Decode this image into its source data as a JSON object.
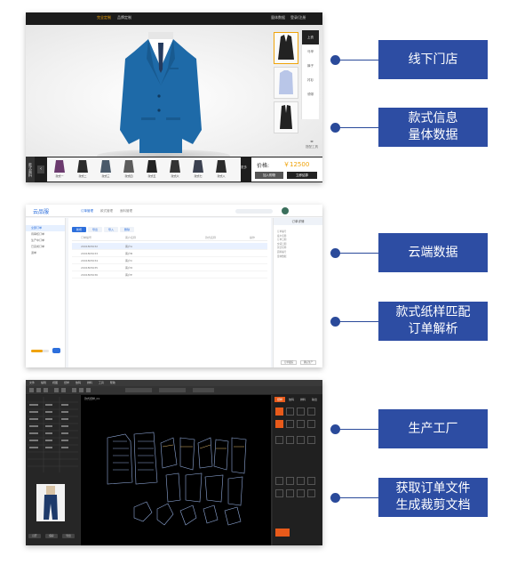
{
  "store_panel": {
    "top_tabs": [
      "完全定制",
      "品牌定制"
    ],
    "top_right": [
      "量体数据",
      "登录/注册"
    ],
    "menu": [
      "上衣",
      "马甲",
      "裤子",
      "衬衫",
      "领带"
    ],
    "tool_label": "搭配工具",
    "side_label": "款式面料",
    "more_label": "更多",
    "styles": [
      "款式一",
      "款式二",
      "款式三",
      "款式四",
      "款式五",
      "款式六",
      "款式七",
      "款式八"
    ],
    "price_label": "价格:",
    "price": "￥12500",
    "add_cart": "加入购物",
    "checkout": "立即结算",
    "colors": {
      "accent": "#f0a30a",
      "suit": "#1e6aa8",
      "dark": "#1e1e1e"
    }
  },
  "cloud_panel": {
    "logo": "云品服",
    "tabs": [
      "订单管理",
      "款式管理",
      "面料管理"
    ],
    "sidebar": [
      "全部订单",
      "待审核订单",
      "生产中订单",
      "已完成订单",
      "退单"
    ],
    "buttons": [
      "新增",
      "导出",
      "导入",
      "删除"
    ],
    "columns": [
      "订单编号",
      "客户名称",
      "款式名称",
      "操作"
    ],
    "rows": [
      [
        "2001805032",
        "客户A"
      ],
      [
        "2001805033",
        "客户B"
      ],
      [
        "2001805034",
        "客户C"
      ],
      [
        "2001805035",
        "客户D"
      ],
      [
        "2001805036",
        "客户E"
      ]
    ],
    "right_title": "订单详情",
    "right_fields": [
      "订单编号",
      "客户名称",
      "订单日期",
      "交货日期",
      "款式名称",
      "面料编号",
      "量体数据"
    ],
    "right_buttons": [
      "订单跟踪",
      "确认生产"
    ],
    "progress": 0.65
  },
  "factory_panel": {
    "menu": [
      "文件",
      "编辑",
      "视图",
      "纸样",
      "放码",
      "排料",
      "工具",
      "帮助"
    ],
    "canvas_tab": "款式纸样_01",
    "right_tabs": [
      "纸样",
      "放码",
      "排料",
      "输出"
    ],
    "left_buttons": [
      "打开",
      "保存",
      "导出"
    ],
    "colors": {
      "accent": "#e85a1a"
    }
  },
  "badges": [
    {
      "lines": [
        "线下门店"
      ]
    },
    {
      "lines": [
        "款式信息",
        "量体数据"
      ]
    },
    {
      "lines": [
        "云端数据"
      ]
    },
    {
      "lines": [
        "款式纸样匹配",
        "订单解析"
      ]
    },
    {
      "lines": [
        "生产工厂"
      ]
    },
    {
      "lines": [
        "获取订单文件",
        "生成裁剪文档"
      ]
    }
  ]
}
